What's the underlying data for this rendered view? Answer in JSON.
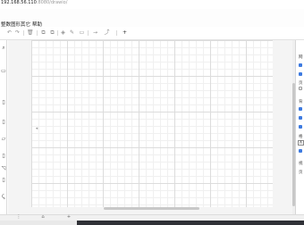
{
  "address_bar": {
    "host": "192.168.56.110",
    "path": ":8080/drawio/"
  },
  "menu": {
    "items": [
      "整数图形",
      "其它",
      "帮助"
    ]
  },
  "toolbar": {
    "undo": "↶",
    "redo": "↷",
    "delete": "🗑",
    "to_front": "⧉",
    "to_back": "⧉",
    "fill": "◈",
    "line_color": "✎",
    "shadow": "▭",
    "connection": "→",
    "waypoints": "⤴",
    "insert": "+"
  },
  "left_panel": {
    "icons": [
      "⌕",
      "▭",
      "▯",
      "▯",
      "▱",
      "▯",
      "◹",
      "▯",
      "⤹"
    ]
  },
  "right_panel": {
    "labels": [
      "网",
      "页",
      "背",
      "格",
      "视",
      "页"
    ],
    "checkbox_states": [
      true,
      true,
      true,
      false,
      true,
      true,
      true
    ],
    "selected_box": "A"
  },
  "page_bar": {
    "icons": [
      "⋮",
      "⌂",
      "+"
    ]
  },
  "colors": {
    "accent": "#3d7ae0",
    "grid_major": "#dcdcdc",
    "grid_minor": "#f0f0f0",
    "taskbar": "#2f3136"
  }
}
